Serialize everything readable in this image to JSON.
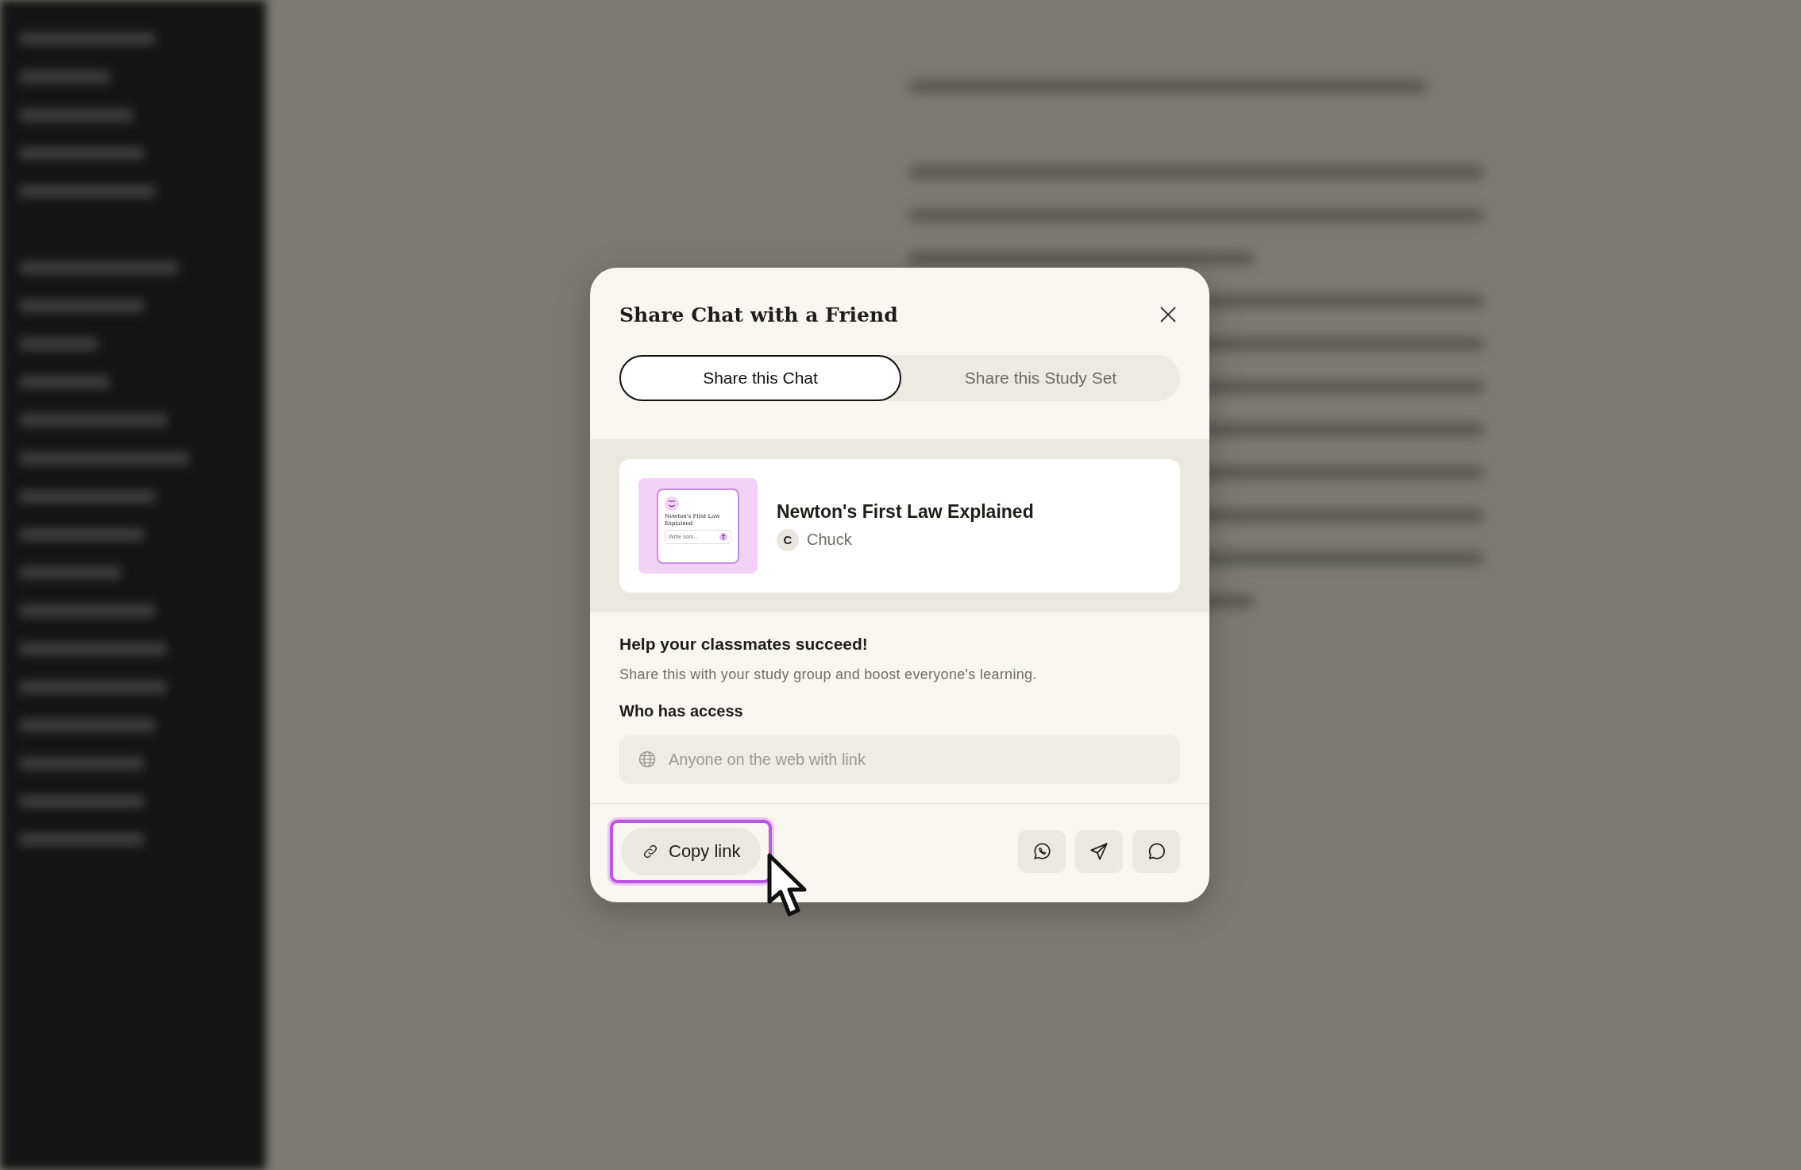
{
  "dialog": {
    "title": "Share Chat with a Friend",
    "tabs": [
      {
        "label": "Share this Chat",
        "selected": true
      },
      {
        "label": "Share this Study Set",
        "selected": false
      }
    ],
    "preview": {
      "thumbnail_title": "Newton's First Law Explained",
      "thumbnail_input": "Write som...",
      "title": "Newton's First Law Explained",
      "author_initial": "C",
      "author": "Chuck"
    },
    "heading": "Help your classmates succeed!",
    "description": "Share this with your study group and boost everyone's learning.",
    "access_label": "Who has access",
    "access_field": {
      "placeholder": "Anyone on the web with link"
    },
    "copy_button": {
      "label": "Copy link",
      "focused": true
    },
    "share_buttons": [
      {
        "kind": "whatsapp"
      },
      {
        "kind": "send"
      },
      {
        "kind": "message"
      }
    ]
  }
}
